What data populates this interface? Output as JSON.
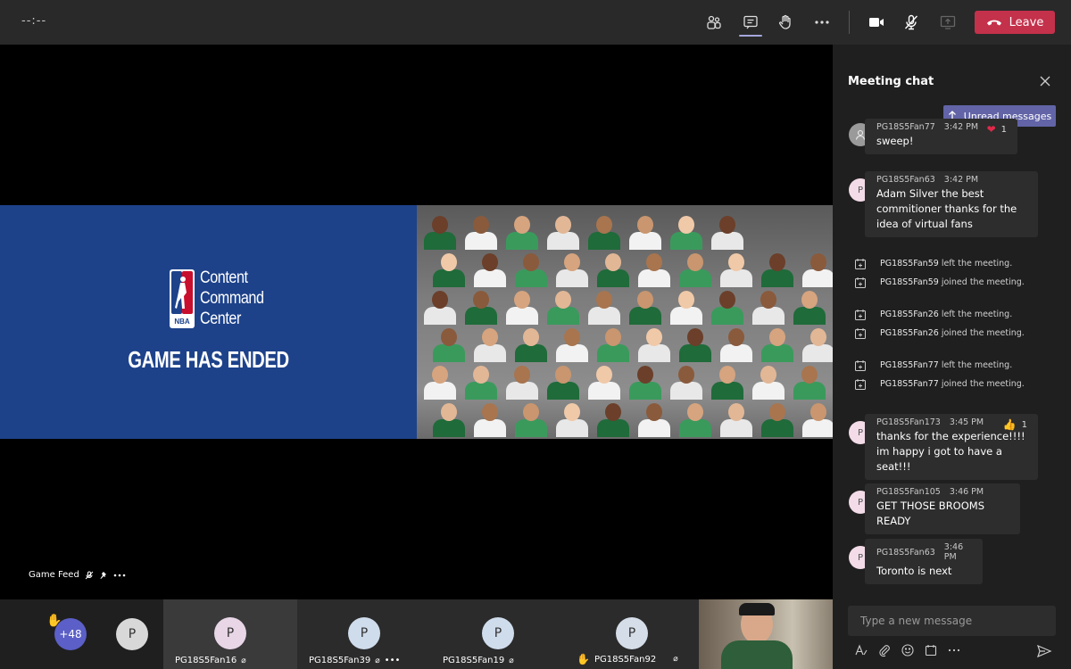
{
  "topbar": {
    "timer": "--:--",
    "leave_label": "Leave",
    "icons": [
      "participants-icon",
      "chat-icon",
      "raise-hand-icon",
      "more-icon",
      "camera-icon",
      "mic-off-icon",
      "share-screen-icon",
      "phone-hangup-icon"
    ],
    "leave_color": "#c4314b",
    "accent": "#6264a7"
  },
  "stage": {
    "content_title_lines": [
      "Content",
      "Command",
      "Center"
    ],
    "logo_text": "NBA",
    "game_status": "GAME HAS ENDED",
    "feed_label": "Game Feed",
    "content_bg": "#1d428a"
  },
  "participants": {
    "overflow": "+48",
    "tiles": [
      {
        "initial": "P",
        "name": ""
      },
      {
        "initial": "P",
        "name": "PG18S5Fan16"
      },
      {
        "initial": "P",
        "name": "PG18S5Fan39"
      },
      {
        "initial": "P",
        "name": "PG18S5Fan19"
      },
      {
        "initial": "P",
        "name": "PG18S5Fan92"
      }
    ]
  },
  "chat": {
    "title": "Meeting chat",
    "unread_label": "Unread messages",
    "messages": [
      {
        "author": "PG18S5Fan77",
        "time": "3:42 PM",
        "text": "sweep!",
        "reaction_count": "1",
        "reaction": "heart"
      },
      {
        "author": "PG18S5Fan63",
        "time": "3:42 PM",
        "text": "Adam Silver the best commitioner thanks for the idea of virtual fans",
        "initial": "P"
      },
      {
        "author": "PG18S5Fan173",
        "time": "3:45 PM",
        "text": "thanks for the experience!!!! im happy i got to have a seat!!!",
        "initial": "P",
        "reaction_count": "1",
        "reaction": "like"
      },
      {
        "author": "PG18S5Fan105",
        "time": "3:46 PM",
        "text": "GET THOSE BROOMS READY",
        "initial": "P"
      },
      {
        "author": "PG18S5Fan63",
        "time": "3:46 PM",
        "text": "Toronto is next",
        "initial": "P"
      }
    ],
    "system": [
      {
        "name": "PG18S5Fan59",
        "action": "left the meeting."
      },
      {
        "name": "PG18S5Fan59",
        "action": "joined the meeting."
      },
      {
        "name": "PG18S5Fan26",
        "action": "left the meeting."
      },
      {
        "name": "PG18S5Fan26",
        "action": "joined the meeting."
      },
      {
        "name": "PG18S5Fan77",
        "action": "left the meeting."
      },
      {
        "name": "PG18S5Fan77",
        "action": "joined the meeting."
      }
    ],
    "compose_placeholder": "Type a new message"
  }
}
